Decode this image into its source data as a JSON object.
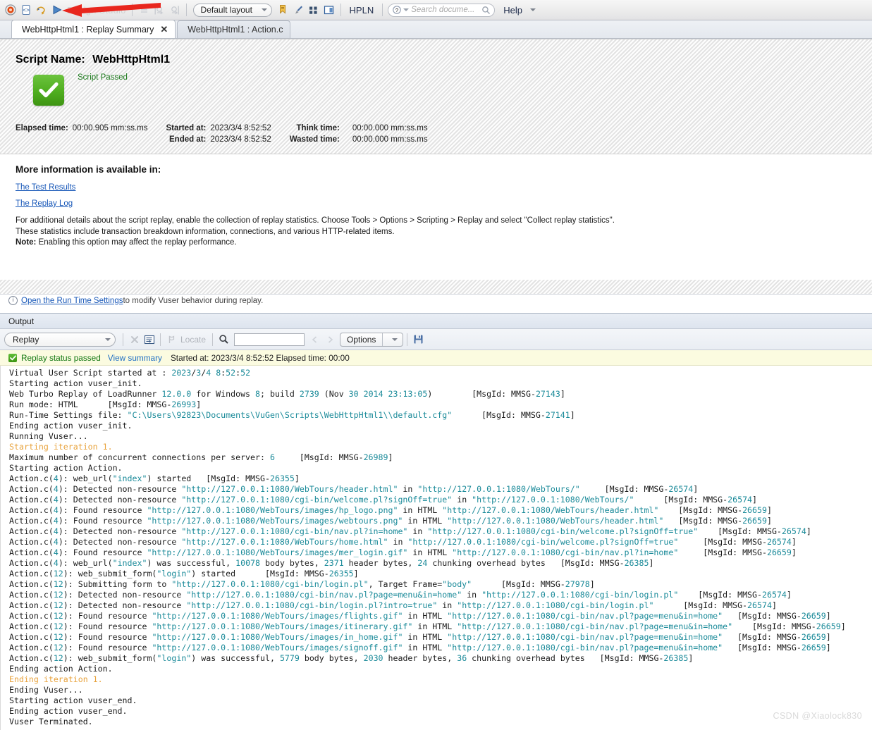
{
  "toolbar": {
    "icons": [
      {
        "name": "record-icon"
      },
      {
        "name": "script-icon"
      },
      {
        "name": "replay-with-script-icon"
      },
      {
        "name": "run-play-icon"
      }
    ],
    "ghost_label": "Design Studio",
    "disabled_icons": [
      {
        "name": "list-view-icon"
      },
      {
        "name": "step-into-icon"
      },
      {
        "name": "step-out-icon"
      }
    ],
    "layout_select": "Default layout",
    "right_icons": [
      {
        "name": "bookmark-icon"
      },
      {
        "name": "brush-icon"
      },
      {
        "name": "grid-icon"
      },
      {
        "name": "window-panel-icon"
      }
    ],
    "hpln_label": "HPLN",
    "search_placeholder": "Search docume...",
    "help_label": "Help"
  },
  "tabs": [
    {
      "label": "WebHttpHtml1 : Replay Summary",
      "active": true,
      "closable": true
    },
    {
      "label": "WebHttpHtml1 : Action.c",
      "active": false,
      "closable": false
    }
  ],
  "summary": {
    "script_name_label": "Script Name:",
    "script_name_value": "WebHttpHtml1",
    "status_text": "Script Passed",
    "status_color": "#1c7a1c",
    "metrics": [
      {
        "key": "Elapsed time:",
        "value": "00:00.905 mm:ss.ms"
      },
      {
        "key": "Started at:",
        "value": "2023/3/4 8:52:52"
      },
      {
        "key": "Think time:",
        "value": "00:00.000 mm:ss.ms"
      },
      {
        "key": "Ended at:",
        "value": "2023/3/4 8:52:52"
      },
      {
        "key": "Wasted time:",
        "value": "00:00.000 mm:ss.ms"
      }
    ],
    "more_info_title": "More information is available in:",
    "links": [
      {
        "label": "The Test Results"
      },
      {
        "label": "The Replay Log"
      }
    ],
    "paragraph_line1": "For additional details about the script replay, enable the collection of replay statistics. Choose Tools > Options > Scripting > Replay and select \"Collect replay statistics\".",
    "paragraph_line2": "These statistics include transaction breakdown information, connections, and various HTTP-related items.",
    "note_label": "Note:",
    "note_text": " Enabling this option may affect the replay performance.",
    "runtime_link": "Open the Run Time Settings",
    "runtime_rest": " to modify Vuser behavior during replay."
  },
  "output": {
    "title": "Output",
    "filter_select": "Replay",
    "clear_icon": "clear-icon",
    "wrap_icon": "word-wrap-icon",
    "locate_label": "Locate",
    "search_icon": "search-icon",
    "search_value": "",
    "prev_icon": "prev-arrow-icon",
    "next_icon": "next-arrow-icon",
    "options_label": "Options",
    "save_icon": "save-icon",
    "status": {
      "text": "Replay status passed",
      "view_summary": "View summary",
      "meta": "Started at: 2023/3/4 8:52:52 Elapsed time: 00:00"
    }
  },
  "log_lines": [
    [
      {
        "t": "Virtual User Script started at : ",
        "c": "k"
      },
      {
        "t": "2023",
        "c": "n"
      },
      {
        "t": "/",
        "c": "k"
      },
      {
        "t": "3",
        "c": "n"
      },
      {
        "t": "/",
        "c": "k"
      },
      {
        "t": "4",
        "c": "n"
      },
      {
        "t": " ",
        "c": "k"
      },
      {
        "t": "8",
        "c": "n"
      },
      {
        "t": ":",
        "c": "k"
      },
      {
        "t": "52",
        "c": "n"
      },
      {
        "t": ":",
        "c": "k"
      },
      {
        "t": "52",
        "c": "n"
      }
    ],
    [
      {
        "t": "Starting action vuser_init.",
        "c": "k"
      }
    ],
    [
      {
        "t": "Web Turbo Replay of LoadRunner ",
        "c": "k"
      },
      {
        "t": "12.0.0",
        "c": "n"
      },
      {
        "t": " for Windows ",
        "c": "k"
      },
      {
        "t": "8",
        "c": "n"
      },
      {
        "t": "; build ",
        "c": "k"
      },
      {
        "t": "2739",
        "c": "n"
      },
      {
        "t": " (Nov ",
        "c": "k"
      },
      {
        "t": "30",
        "c": "n"
      },
      {
        "t": " ",
        "c": "k"
      },
      {
        "t": "2014",
        "c": "n"
      },
      {
        "t": " ",
        "c": "k"
      },
      {
        "t": "23:13:05",
        "c": "n"
      },
      {
        "t": ")        [MsgId: MMSG-",
        "c": "k"
      },
      {
        "t": "27143",
        "c": "n"
      },
      {
        "t": "]",
        "c": "k"
      }
    ],
    [
      {
        "t": "Run mode: HTML      [MsgId: MMSG-",
        "c": "k"
      },
      {
        "t": "26993",
        "c": "n"
      },
      {
        "t": "]",
        "c": "k"
      }
    ],
    [
      {
        "t": "Run-Time Settings file: ",
        "c": "k"
      },
      {
        "t": "\"C:\\Users\\92823\\Documents\\VuGen\\Scripts\\WebHttpHtml1\\\\default.cfg\"",
        "c": "n"
      },
      {
        "t": "      [MsgId: MMSG-",
        "c": "k"
      },
      {
        "t": "27141",
        "c": "n"
      },
      {
        "t": "]",
        "c": "k"
      }
    ],
    [
      {
        "t": "Ending action vuser_init.",
        "c": "k"
      }
    ],
    [
      {
        "t": "Running Vuser...",
        "c": "k"
      }
    ],
    [
      {
        "t": "Starting iteration 1.",
        "c": "o"
      }
    ],
    [
      {
        "t": "Maximum number of concurrent connections per server: ",
        "c": "k"
      },
      {
        "t": "6",
        "c": "n"
      },
      {
        "t": "     [MsgId: MMSG-",
        "c": "k"
      },
      {
        "t": "26989",
        "c": "n"
      },
      {
        "t": "]",
        "c": "k"
      }
    ],
    [
      {
        "t": "Starting action Action.",
        "c": "k"
      }
    ],
    [
      {
        "t": "Action.c(",
        "c": "k"
      },
      {
        "t": "4",
        "c": "n"
      },
      {
        "t": "): web_url(",
        "c": "k"
      },
      {
        "t": "\"index\"",
        "c": "n"
      },
      {
        "t": ") started   [MsgId: MMSG-",
        "c": "k"
      },
      {
        "t": "26355",
        "c": "n"
      },
      {
        "t": "]",
        "c": "k"
      }
    ],
    [
      {
        "t": "Action.c(",
        "c": "k"
      },
      {
        "t": "4",
        "c": "n"
      },
      {
        "t": "): Detected non-resource ",
        "c": "k"
      },
      {
        "t": "\"http://127.0.0.1:1080/WebTours/header.html\"",
        "c": "n"
      },
      {
        "t": " in ",
        "c": "k"
      },
      {
        "t": "\"http://127.0.0.1:1080/WebTours/\"",
        "c": "n"
      },
      {
        "t": "     [MsgId: MMSG-",
        "c": "k"
      },
      {
        "t": "26574",
        "c": "n"
      },
      {
        "t": "]",
        "c": "k"
      }
    ],
    [
      {
        "t": "Action.c(",
        "c": "k"
      },
      {
        "t": "4",
        "c": "n"
      },
      {
        "t": "): Detected non-resource ",
        "c": "k"
      },
      {
        "t": "\"http://127.0.0.1:1080/cgi-bin/welcome.pl?signOff=true\"",
        "c": "n"
      },
      {
        "t": " in ",
        "c": "k"
      },
      {
        "t": "\"http://127.0.0.1:1080/WebTours/\"",
        "c": "n"
      },
      {
        "t": "      [MsgId: MMSG-",
        "c": "k"
      },
      {
        "t": "26574",
        "c": "n"
      },
      {
        "t": "]",
        "c": "k"
      }
    ],
    [
      {
        "t": "Action.c(",
        "c": "k"
      },
      {
        "t": "4",
        "c": "n"
      },
      {
        "t": "): Found resource ",
        "c": "k"
      },
      {
        "t": "\"http://127.0.0.1:1080/WebTours/images/hp_logo.png\"",
        "c": "n"
      },
      {
        "t": " in HTML ",
        "c": "k"
      },
      {
        "t": "\"http://127.0.0.1:1080/WebTours/header.html\"",
        "c": "n"
      },
      {
        "t": "    [MsgId: MMSG-",
        "c": "k"
      },
      {
        "t": "26659",
        "c": "n"
      },
      {
        "t": "]",
        "c": "k"
      }
    ],
    [
      {
        "t": "Action.c(",
        "c": "k"
      },
      {
        "t": "4",
        "c": "n"
      },
      {
        "t": "): Found resource ",
        "c": "k"
      },
      {
        "t": "\"http://127.0.0.1:1080/WebTours/images/webtours.png\"",
        "c": "n"
      },
      {
        "t": " in HTML ",
        "c": "k"
      },
      {
        "t": "\"http://127.0.0.1:1080/WebTours/header.html\"",
        "c": "n"
      },
      {
        "t": "   [MsgId: MMSG-",
        "c": "k"
      },
      {
        "t": "26659",
        "c": "n"
      },
      {
        "t": "]",
        "c": "k"
      }
    ],
    [
      {
        "t": "Action.c(",
        "c": "k"
      },
      {
        "t": "4",
        "c": "n"
      },
      {
        "t": "): Detected non-resource ",
        "c": "k"
      },
      {
        "t": "\"http://127.0.0.1:1080/cgi-bin/nav.pl?in=home\"",
        "c": "n"
      },
      {
        "t": " in ",
        "c": "k"
      },
      {
        "t": "\"http://127.0.0.1:1080/cgi-bin/welcome.pl?signOff=true\"",
        "c": "n"
      },
      {
        "t": "    [MsgId: MMSG-",
        "c": "k"
      },
      {
        "t": "26574",
        "c": "n"
      },
      {
        "t": "]",
        "c": "k"
      }
    ],
    [
      {
        "t": "Action.c(",
        "c": "k"
      },
      {
        "t": "4",
        "c": "n"
      },
      {
        "t": "): Detected non-resource ",
        "c": "k"
      },
      {
        "t": "\"http://127.0.0.1:1080/WebTours/home.html\"",
        "c": "n"
      },
      {
        "t": " in ",
        "c": "k"
      },
      {
        "t": "\"http://127.0.0.1:1080/cgi-bin/welcome.pl?signOff=true\"",
        "c": "n"
      },
      {
        "t": "     [MsgId: MMSG-",
        "c": "k"
      },
      {
        "t": "26574",
        "c": "n"
      },
      {
        "t": "]",
        "c": "k"
      }
    ],
    [
      {
        "t": "Action.c(",
        "c": "k"
      },
      {
        "t": "4",
        "c": "n"
      },
      {
        "t": "): Found resource ",
        "c": "k"
      },
      {
        "t": "\"http://127.0.0.1:1080/WebTours/images/mer_login.gif\"",
        "c": "n"
      },
      {
        "t": " in HTML ",
        "c": "k"
      },
      {
        "t": "\"http://127.0.0.1:1080/cgi-bin/nav.pl?in=home\"",
        "c": "n"
      },
      {
        "t": "     [MsgId: MMSG-",
        "c": "k"
      },
      {
        "t": "26659",
        "c": "n"
      },
      {
        "t": "]",
        "c": "k"
      }
    ],
    [
      {
        "t": "Action.c(",
        "c": "k"
      },
      {
        "t": "4",
        "c": "n"
      },
      {
        "t": "): web_url(",
        "c": "k"
      },
      {
        "t": "\"index\"",
        "c": "n"
      },
      {
        "t": ") was successful, ",
        "c": "k"
      },
      {
        "t": "10078",
        "c": "n"
      },
      {
        "t": " body bytes, ",
        "c": "k"
      },
      {
        "t": "2371",
        "c": "n"
      },
      {
        "t": " header bytes, ",
        "c": "k"
      },
      {
        "t": "24",
        "c": "n"
      },
      {
        "t": " chunking overhead bytes   [MsgId: MMSG-",
        "c": "k"
      },
      {
        "t": "26385",
        "c": "n"
      },
      {
        "t": "]",
        "c": "k"
      }
    ],
    [
      {
        "t": "Action.c(",
        "c": "k"
      },
      {
        "t": "12",
        "c": "n"
      },
      {
        "t": "): web_submit_form(",
        "c": "k"
      },
      {
        "t": "\"login\"",
        "c": "n"
      },
      {
        "t": ") started      [MsgId: MMSG-",
        "c": "k"
      },
      {
        "t": "26355",
        "c": "n"
      },
      {
        "t": "]",
        "c": "k"
      }
    ],
    [
      {
        "t": "Action.c(",
        "c": "k"
      },
      {
        "t": "12",
        "c": "n"
      },
      {
        "t": "): Submitting form to ",
        "c": "k"
      },
      {
        "t": "\"http://127.0.0.1:1080/cgi-bin/login.pl\"",
        "c": "n"
      },
      {
        "t": ", Target Frame=",
        "c": "k"
      },
      {
        "t": "\"body\"",
        "c": "n"
      },
      {
        "t": "      [MsgId: MMSG-",
        "c": "k"
      },
      {
        "t": "27978",
        "c": "n"
      },
      {
        "t": "]",
        "c": "k"
      }
    ],
    [
      {
        "t": "Action.c(",
        "c": "k"
      },
      {
        "t": "12",
        "c": "n"
      },
      {
        "t": "): Detected non-resource ",
        "c": "k"
      },
      {
        "t": "\"http://127.0.0.1:1080/cgi-bin/nav.pl?page=menu&in=home\"",
        "c": "n"
      },
      {
        "t": " in ",
        "c": "k"
      },
      {
        "t": "\"http://127.0.0.1:1080/cgi-bin/login.pl\"",
        "c": "n"
      },
      {
        "t": "    [MsgId: MMSG-",
        "c": "k"
      },
      {
        "t": "26574",
        "c": "n"
      },
      {
        "t": "]",
        "c": "k"
      }
    ],
    [
      {
        "t": "Action.c(",
        "c": "k"
      },
      {
        "t": "12",
        "c": "n"
      },
      {
        "t": "): Detected non-resource ",
        "c": "k"
      },
      {
        "t": "\"http://127.0.0.1:1080/cgi-bin/login.pl?intro=true\"",
        "c": "n"
      },
      {
        "t": " in ",
        "c": "k"
      },
      {
        "t": "\"http://127.0.0.1:1080/cgi-bin/login.pl\"",
        "c": "n"
      },
      {
        "t": "      [MsgId: MMSG-",
        "c": "k"
      },
      {
        "t": "26574",
        "c": "n"
      },
      {
        "t": "]",
        "c": "k"
      }
    ],
    [
      {
        "t": "Action.c(",
        "c": "k"
      },
      {
        "t": "12",
        "c": "n"
      },
      {
        "t": "): Found resource ",
        "c": "k"
      },
      {
        "t": "\"http://127.0.0.1:1080/WebTours/images/flights.gif\"",
        "c": "n"
      },
      {
        "t": " in HTML ",
        "c": "k"
      },
      {
        "t": "\"http://127.0.0.1:1080/cgi-bin/nav.pl?page=menu&in=home\"",
        "c": "n"
      },
      {
        "t": "   [MsgId: MMSG-",
        "c": "k"
      },
      {
        "t": "26659",
        "c": "n"
      },
      {
        "t": "]",
        "c": "k"
      }
    ],
    [
      {
        "t": "Action.c(",
        "c": "k"
      },
      {
        "t": "12",
        "c": "n"
      },
      {
        "t": "): Found resource ",
        "c": "k"
      },
      {
        "t": "\"http://127.0.0.1:1080/WebTours/images/itinerary.gif\"",
        "c": "n"
      },
      {
        "t": " in HTML ",
        "c": "k"
      },
      {
        "t": "\"http://127.0.0.1:1080/cgi-bin/nav.pl?page=menu&in=home\"",
        "c": "n"
      },
      {
        "t": "    [MsgId: MMSG-",
        "c": "k"
      },
      {
        "t": "26659",
        "c": "n"
      },
      {
        "t": "]",
        "c": "k"
      }
    ],
    [
      {
        "t": "Action.c(",
        "c": "k"
      },
      {
        "t": "12",
        "c": "n"
      },
      {
        "t": "): Found resource ",
        "c": "k"
      },
      {
        "t": "\"http://127.0.0.1:1080/WebTours/images/in_home.gif\"",
        "c": "n"
      },
      {
        "t": " in HTML ",
        "c": "k"
      },
      {
        "t": "\"http://127.0.0.1:1080/cgi-bin/nav.pl?page=menu&in=home\"",
        "c": "n"
      },
      {
        "t": "   [MsgId: MMSG-",
        "c": "k"
      },
      {
        "t": "26659",
        "c": "n"
      },
      {
        "t": "]",
        "c": "k"
      }
    ],
    [
      {
        "t": "Action.c(",
        "c": "k"
      },
      {
        "t": "12",
        "c": "n"
      },
      {
        "t": "): Found resource ",
        "c": "k"
      },
      {
        "t": "\"http://127.0.0.1:1080/WebTours/images/signoff.gif\"",
        "c": "n"
      },
      {
        "t": " in HTML ",
        "c": "k"
      },
      {
        "t": "\"http://127.0.0.1:1080/cgi-bin/nav.pl?page=menu&in=home\"",
        "c": "n"
      },
      {
        "t": "   [MsgId: MMSG-",
        "c": "k"
      },
      {
        "t": "26659",
        "c": "n"
      },
      {
        "t": "]",
        "c": "k"
      }
    ],
    [
      {
        "t": "Action.c(",
        "c": "k"
      },
      {
        "t": "12",
        "c": "n"
      },
      {
        "t": "): web_submit_form(",
        "c": "k"
      },
      {
        "t": "\"login\"",
        "c": "n"
      },
      {
        "t": ") was successful, ",
        "c": "k"
      },
      {
        "t": "5779",
        "c": "n"
      },
      {
        "t": " body bytes, ",
        "c": "k"
      },
      {
        "t": "2030",
        "c": "n"
      },
      {
        "t": " header bytes, ",
        "c": "k"
      },
      {
        "t": "36",
        "c": "n"
      },
      {
        "t": " chunking overhead bytes   [MsgId: MMSG-",
        "c": "k"
      },
      {
        "t": "26385",
        "c": "n"
      },
      {
        "t": "]",
        "c": "k"
      }
    ],
    [
      {
        "t": "Ending action Action.",
        "c": "k"
      }
    ],
    [
      {
        "t": "Ending iteration 1.",
        "c": "o"
      }
    ],
    [
      {
        "t": "Ending Vuser...",
        "c": "k"
      }
    ],
    [
      {
        "t": "Starting action vuser_end.",
        "c": "k"
      }
    ],
    [
      {
        "t": "Ending action vuser_end.",
        "c": "k"
      }
    ],
    [
      {
        "t": "Vuser Terminated.",
        "c": "k"
      }
    ]
  ],
  "watermark": "CSDN @Xiaolock830"
}
